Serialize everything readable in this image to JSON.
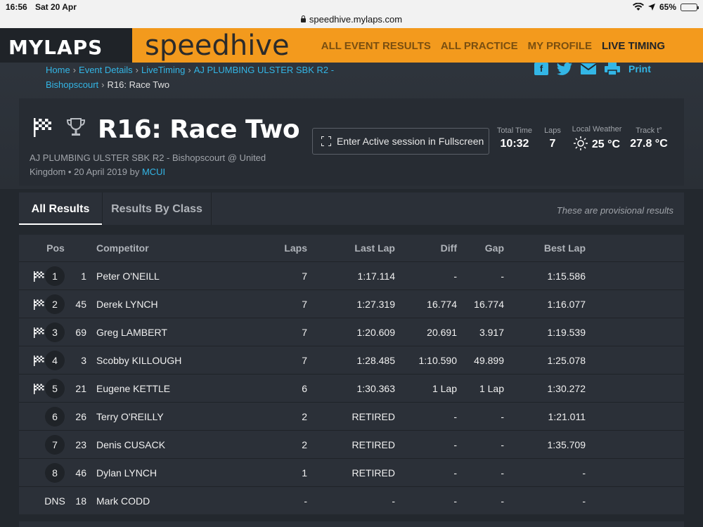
{
  "status_bar": {
    "time": "16:56",
    "date": "Sat 20 Apr",
    "battery": "65%"
  },
  "browser": {
    "url": "speedhive.mylaps.com"
  },
  "header": {
    "logo": "MYLAPS",
    "brand": "speedhive",
    "nav": [
      "ALL EVENT RESULTS",
      "ALL PRACTICE",
      "MY PROFILE",
      "LIVE TIMING"
    ],
    "active_nav": "LIVE TIMING",
    "accent_color": "#f39a1d"
  },
  "breadcrumb": {
    "items": [
      "Home",
      "Event Details",
      "LiveTiming",
      "AJ PLUMBING ULSTER SBK R2 - Bishopscourt"
    ],
    "current": "R16: Race Two"
  },
  "share": {
    "icons": [
      "facebook-icon",
      "twitter-icon",
      "mail-icon",
      "printer-icon"
    ],
    "print_label": "Print"
  },
  "event": {
    "title": "R16: Race Two",
    "subtitle": "AJ PLUMBING ULSTER SBK R2 - Bishopscourt @ United Kingdom • 20 April 2019 by",
    "author": "MCUI",
    "fullscreen_label": "Enter Active session in Fullscreen",
    "stats": [
      {
        "label": "Total Time",
        "value": "10:32"
      },
      {
        "label": "Laps",
        "value": "7"
      },
      {
        "label": "Local Weather",
        "value": "25 °C",
        "icon": "sun-icon"
      },
      {
        "label": "Track t°",
        "value": "27.8 °C"
      }
    ]
  },
  "tabs": {
    "items": [
      "All Results",
      "Results By Class"
    ],
    "active": "All Results",
    "note": "These are provisional results"
  },
  "table": {
    "headers": {
      "pos": "Pos",
      "competitor": "Competitor",
      "laps": "Laps",
      "last_lap": "Last Lap",
      "diff": "Diff",
      "gap": "Gap",
      "best_lap": "Best Lap"
    },
    "rows": [
      {
        "flag": true,
        "pos": "1",
        "num": "1",
        "competitor": "Peter O'NEILL",
        "laps": "7",
        "last_lap": "1:17.114",
        "diff": "-",
        "gap": "-",
        "best_lap": "1:15.586"
      },
      {
        "flag": true,
        "pos": "2",
        "num": "45",
        "competitor": "Derek LYNCH",
        "laps": "7",
        "last_lap": "1:27.319",
        "diff": "16.774",
        "gap": "16.774",
        "best_lap": "1:16.077"
      },
      {
        "flag": true,
        "pos": "3",
        "num": "69",
        "competitor": "Greg LAMBERT",
        "laps": "7",
        "last_lap": "1:20.609",
        "diff": "20.691",
        "gap": "3.917",
        "best_lap": "1:19.539"
      },
      {
        "flag": true,
        "pos": "4",
        "num": "3",
        "competitor": "Scobby KILLOUGH",
        "laps": "7",
        "last_lap": "1:28.485",
        "diff": "1:10.590",
        "gap": "49.899",
        "best_lap": "1:25.078"
      },
      {
        "flag": true,
        "pos": "5",
        "num": "21",
        "competitor": "Eugene KETTLE",
        "laps": "6",
        "last_lap": "1:30.363",
        "diff": "1 Lap",
        "gap": "1 Lap",
        "best_lap": "1:30.272"
      },
      {
        "flag": false,
        "pos": "6",
        "num": "26",
        "competitor": "Terry O'REILLY",
        "laps": "2",
        "last_lap": "RETIRED",
        "diff": "-",
        "gap": "-",
        "best_lap": "1:21.011"
      },
      {
        "flag": false,
        "pos": "7",
        "num": "23",
        "competitor": "Denis CUSACK",
        "laps": "2",
        "last_lap": "RETIRED",
        "diff": "-",
        "gap": "-",
        "best_lap": "1:35.709"
      },
      {
        "flag": false,
        "pos": "8",
        "num": "46",
        "competitor": "Dylan LYNCH",
        "laps": "1",
        "last_lap": "RETIRED",
        "diff": "-",
        "gap": "-",
        "best_lap": "-"
      },
      {
        "flag": false,
        "pos": "DNS",
        "num": "18",
        "competitor": "Mark CODD",
        "laps": "-",
        "last_lap": "-",
        "diff": "-",
        "gap": "-",
        "best_lap": "-"
      }
    ]
  }
}
